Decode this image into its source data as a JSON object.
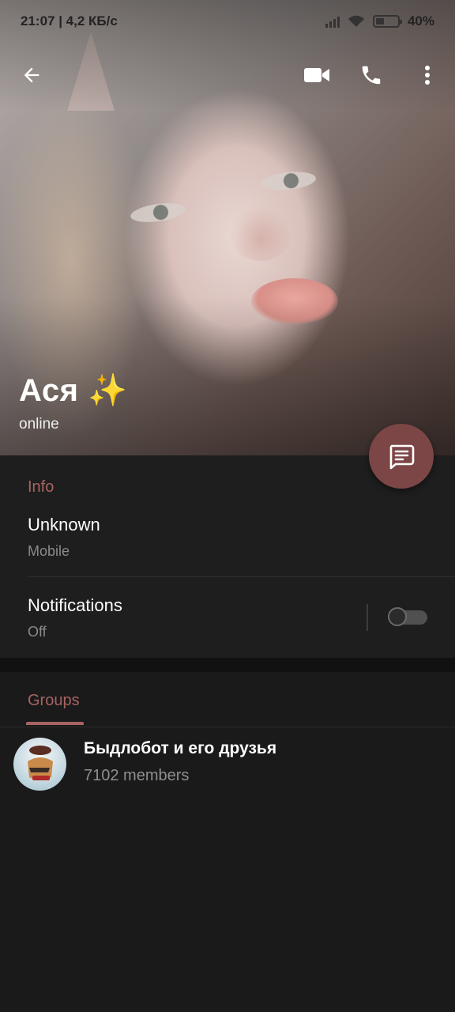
{
  "status_bar": {
    "time_speed": "21:07 | 4,2 КБ/с",
    "battery": "40%",
    "battery_level": 0.4
  },
  "profile": {
    "name": "Ася ✨",
    "status": "online"
  },
  "icons": {
    "back": "arrow-left-icon",
    "video": "video-camera-icon",
    "phone": "phone-icon",
    "more": "more-vertical-icon",
    "message": "message-icon"
  },
  "info": {
    "section_title": "Info",
    "phone_value": "Unknown",
    "phone_label": "Mobile",
    "notifications_label": "Notifications",
    "notifications_value": "Off",
    "notifications_on": false
  },
  "groups": {
    "tab_label": "Groups",
    "items": [
      {
        "name": "Быдлобот и его друзья",
        "members": "7102 members"
      }
    ]
  },
  "colors": {
    "accent": "#a86363",
    "fab": "#7d4646",
    "background": "#1a1a1a"
  }
}
